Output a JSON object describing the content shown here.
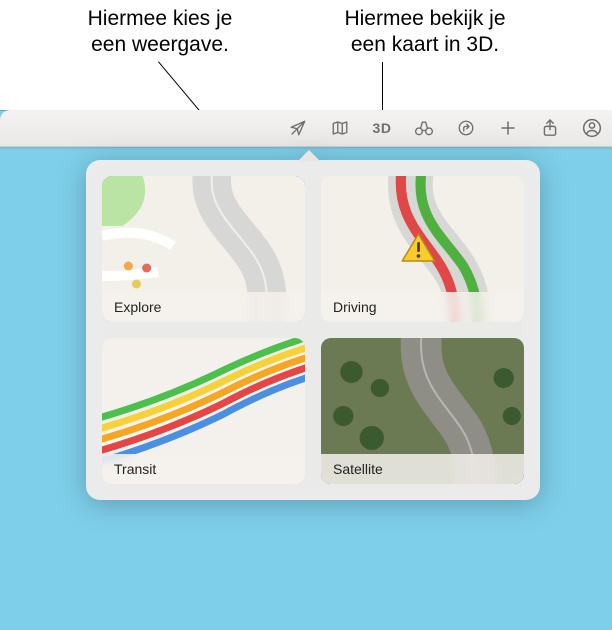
{
  "callouts": {
    "view": {
      "line1": "Hiermee kies je",
      "line2": "een weergave."
    },
    "threeD": {
      "line1": "Hiermee bekijk je",
      "line2": "een kaart in 3D."
    }
  },
  "toolbar": {
    "location_icon": "location-arrow-off",
    "map_mode_icon": "map",
    "threeD_label": "3D",
    "lookaround_icon": "binoculars",
    "directions_icon": "directions",
    "add_icon": "plus",
    "share_icon": "share",
    "account_icon": "account-circle"
  },
  "popover": {
    "tiles": [
      {
        "id": "explore",
        "label": "Explore",
        "selected": true
      },
      {
        "id": "driving",
        "label": "Driving",
        "selected": false
      },
      {
        "id": "transit",
        "label": "Transit",
        "selected": false
      },
      {
        "id": "satellite",
        "label": "Satellite",
        "selected": false
      }
    ]
  }
}
